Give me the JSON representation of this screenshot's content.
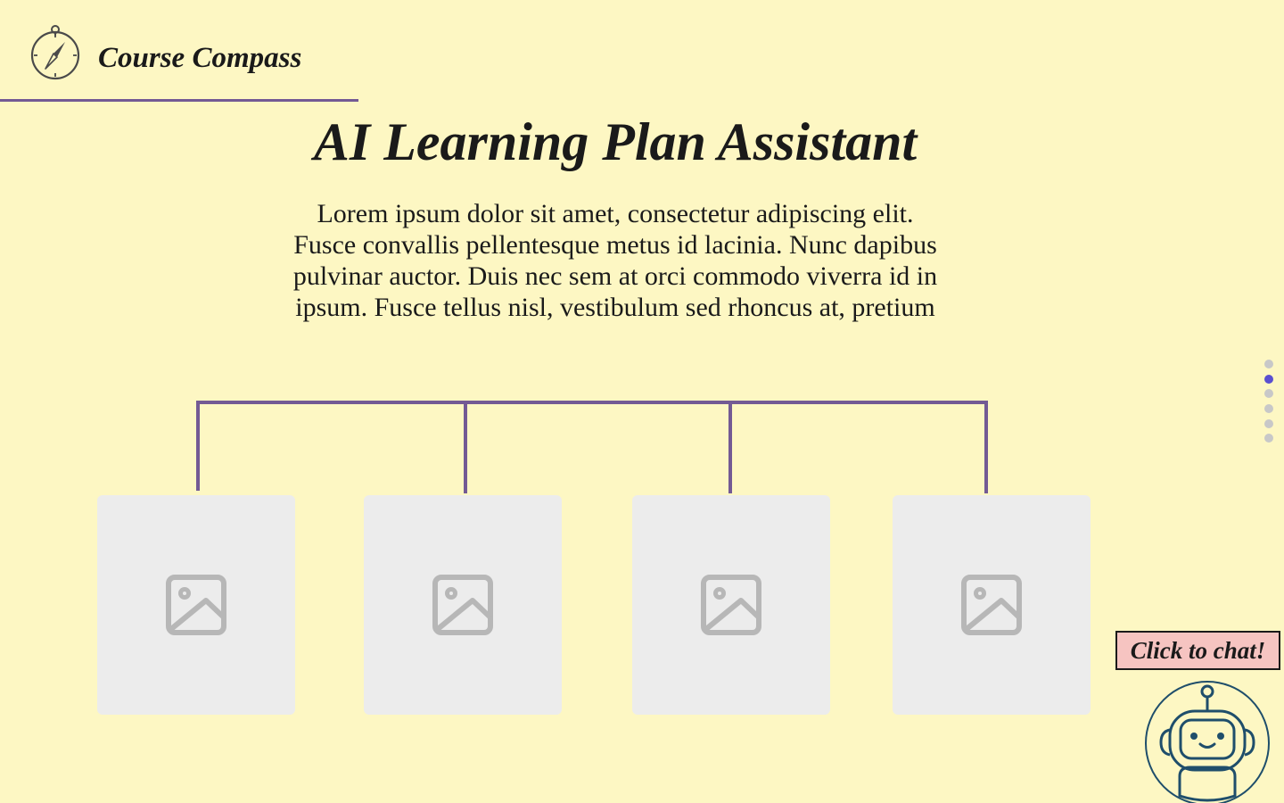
{
  "brand": {
    "name": "Course Compass",
    "icon": "compass-icon"
  },
  "hero": {
    "title": "AI Learning Plan Assistant",
    "intro_lines": [
      "Lorem ipsum dolor sit amet, consectetur adipiscing elit.",
      "Fusce convallis pellentesque metus id lacinia. Nunc dapibus",
      "pulvinar auctor. Duis nec sem at orci commodo viverra id in",
      "ipsum. Fusce tellus nisl, vestibulum sed rhoncus at, pretium"
    ]
  },
  "cards": [
    {
      "icon": "image-placeholder-icon"
    },
    {
      "icon": "image-placeholder-icon"
    },
    {
      "icon": "image-placeholder-icon"
    },
    {
      "icon": "image-placeholder-icon"
    }
  ],
  "pagination": {
    "count": 6,
    "active_index": 1
  },
  "chat": {
    "cta_label": "Click to chat!",
    "icon": "robot-icon"
  },
  "colors": {
    "background": "#fdf7c3",
    "accent": "#735a94",
    "card": "#ececec",
    "placeholder_icon": "#b7b7b7",
    "dot": "#c8c8c8",
    "dot_active": "#5a4fd0",
    "chat_cta": "#f6c4c1",
    "robot": "#1f4e6b"
  }
}
